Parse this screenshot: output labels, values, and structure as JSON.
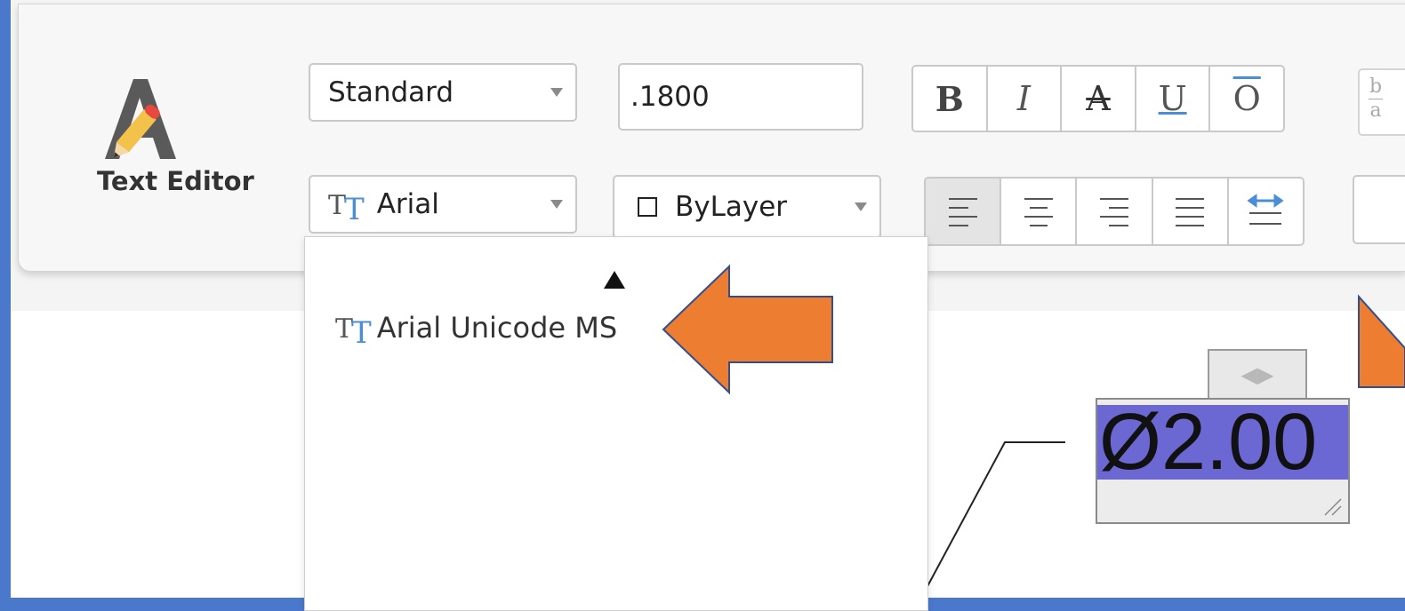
{
  "logo": {
    "label": "Text Editor"
  },
  "style_select": {
    "value": "Standard"
  },
  "height_input": {
    "value": ".1800"
  },
  "font_select": {
    "value": "Arial"
  },
  "color_select": {
    "value": "ByLayer"
  },
  "format_buttons": {
    "bold": "B",
    "italic": "I",
    "strike": "A",
    "underline": "U",
    "overline": "O"
  },
  "align_buttons": [
    "left",
    "center",
    "right",
    "justify",
    "distribute"
  ],
  "font_dropdown": {
    "items": [
      {
        "label": "Arial Unicode MS"
      }
    ]
  },
  "fraction_button": {
    "numerator": "b",
    "denominator": "a"
  },
  "mtext": {
    "value": "Ø2.00"
  },
  "colors": {
    "selection": "#6b68d4",
    "arrow": "#ed7d31",
    "accent": "#4a8fd6",
    "frame": "#4a79cc"
  }
}
